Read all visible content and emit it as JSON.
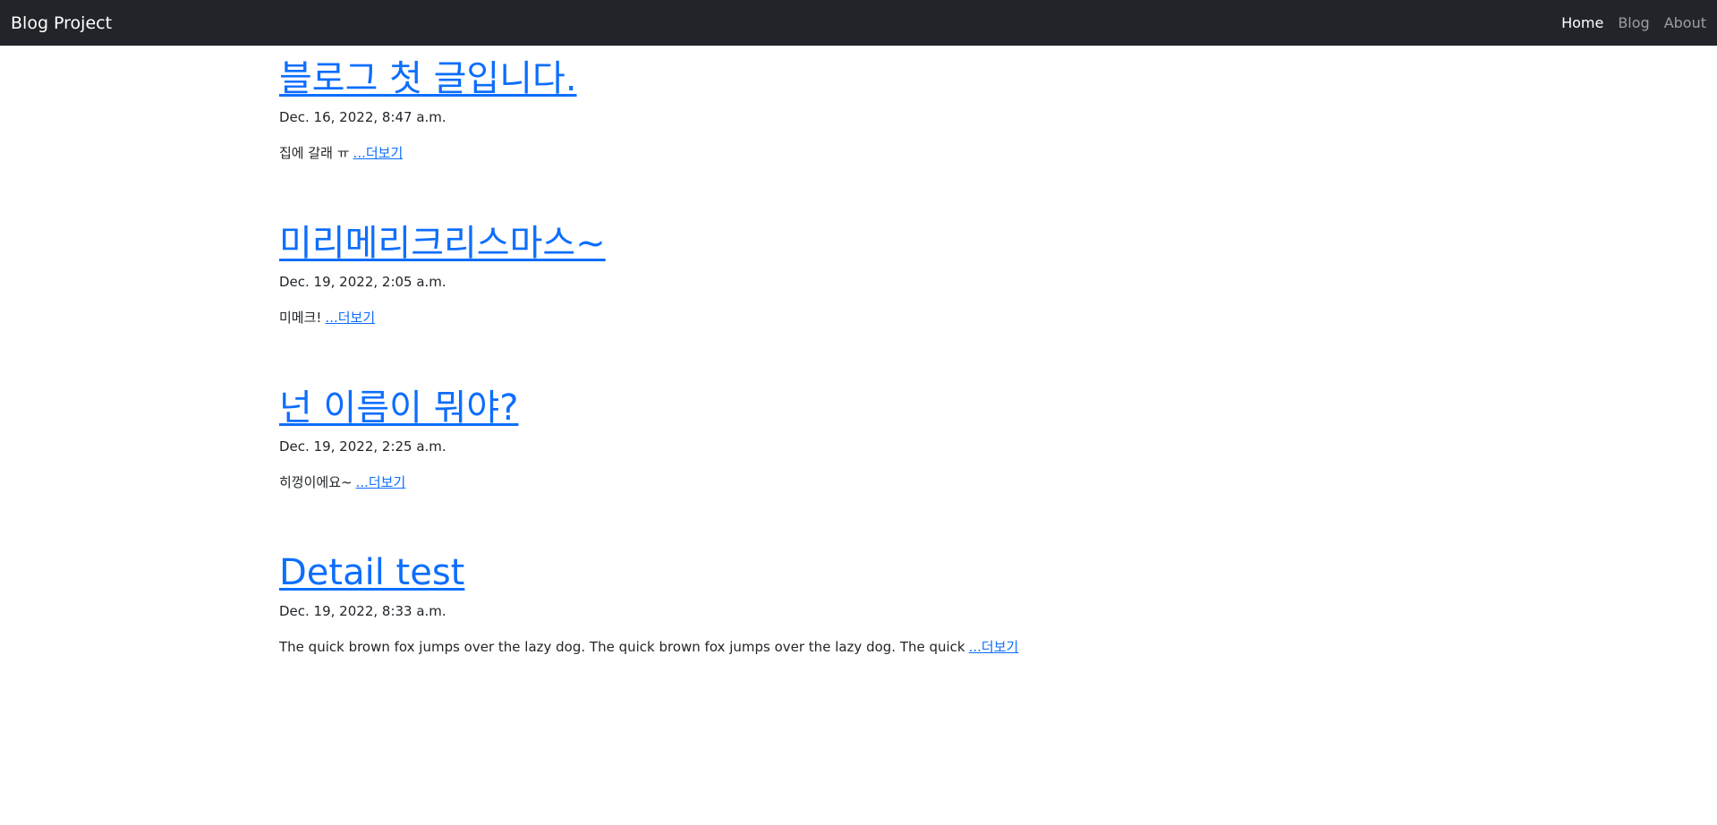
{
  "navbar": {
    "brand": "Blog Project",
    "links": [
      {
        "label": "Home",
        "active": true
      },
      {
        "label": "Blog",
        "active": false
      },
      {
        "label": "About",
        "active": false
      }
    ]
  },
  "posts": [
    {
      "title": "블로그 첫 글입니다.",
      "date": "Dec. 16, 2022, 8:47 a.m.",
      "excerpt": "집에 갈래 ㅠ",
      "more": "...더보기"
    },
    {
      "title": "미리메리크리스마스~",
      "date": "Dec. 19, 2022, 2:05 a.m.",
      "excerpt": "미메크!",
      "more": "...더보기"
    },
    {
      "title": "넌 이름이 뭐야?",
      "date": "Dec. 19, 2022, 2:25 a.m.",
      "excerpt": "히껑이에요~",
      "more": "...더보기"
    },
    {
      "title": "Detail test",
      "date": "Dec. 19, 2022, 8:33 a.m.",
      "excerpt": "The quick brown fox jumps over the lazy dog. The quick brown fox jumps over the lazy dog. The quick",
      "more": "...더보기"
    }
  ],
  "colors": {
    "navbar_bg": "#212529",
    "link": "#0d6efd"
  }
}
